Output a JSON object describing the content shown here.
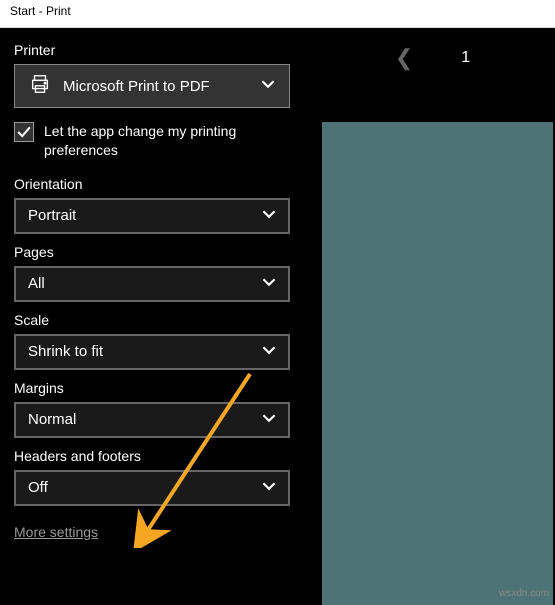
{
  "window": {
    "title": "Start - Print"
  },
  "printer": {
    "label": "Printer",
    "selected": "Microsoft Print to PDF"
  },
  "checkbox": {
    "label": "Let the app change my printing preferences",
    "checked": true
  },
  "orientation": {
    "label": "Orientation",
    "value": "Portrait"
  },
  "pages": {
    "label": "Pages",
    "value": "All"
  },
  "scale": {
    "label": "Scale",
    "value": "Shrink to fit"
  },
  "margins": {
    "label": "Margins",
    "value": "Normal"
  },
  "headers_footers": {
    "label": "Headers and footers",
    "value": "Off"
  },
  "more_settings": "More settings",
  "preview": {
    "page": "1"
  },
  "watermark": "wsxdn.com"
}
